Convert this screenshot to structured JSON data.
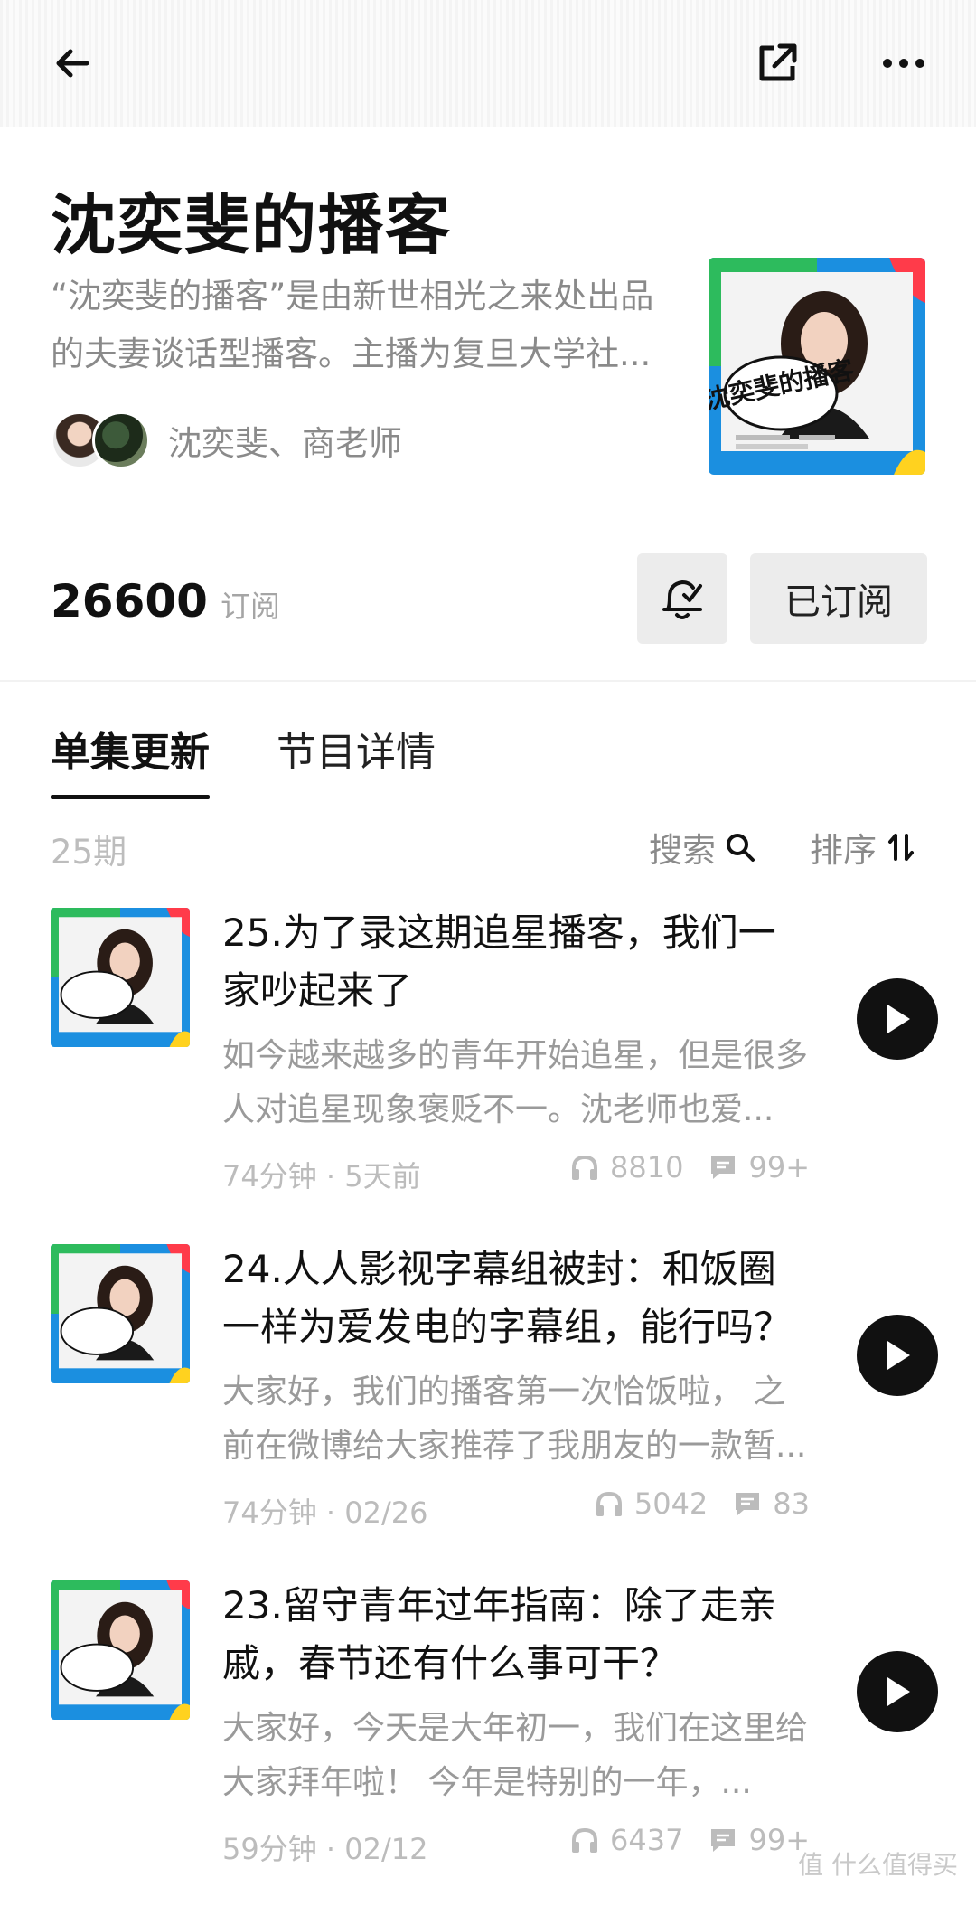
{
  "header": {
    "back_icon": "arrow-left-icon",
    "share_icon": "share-icon",
    "more_icon": "more-horizontal-icon"
  },
  "podcast": {
    "title": "沈奕斐的播客",
    "description": "“沈奕斐的播客”是由新世相光之来处出品的夫妻谈话型播客。主播为复旦大学社...",
    "hosts": "沈奕斐、商老师",
    "subscribers": "26600",
    "subscribers_label": "订阅",
    "subscribed_label": "已订阅",
    "cover_title": "沈奕斐的播客"
  },
  "tabs": [
    {
      "label": "单集更新",
      "active": true
    },
    {
      "label": "节目详情",
      "active": false
    }
  ],
  "list_header": {
    "count": "25期",
    "search_label": "搜索",
    "sort_label": "排序"
  },
  "episodes": [
    {
      "title": "25.为了录这期追星播客，我们一家吵起来了",
      "summary": "如今越来越多的青年开始追星，但是很多人对追星现象褒贬不一。沈老师也爱...",
      "duration_date": "74分钟 · 5天前",
      "plays": "8810",
      "comments": "99+"
    },
    {
      "title": "24.人人影视字幕组被封：和饭圈一样为爱发电的字幕组，能行吗？",
      "summary": "大家好，我们的播客第一次恰饭啦， 之前在微博给大家推荐了我朋友的一款暂...",
      "duration_date": "74分钟 · 02/26",
      "plays": "5042",
      "comments": "83"
    },
    {
      "title": "23.留守青年过年指南：除了走亲戚，春节还有什么事可干？",
      "summary": "大家好，今天是大年初一，我们在这里给大家拜年啦！ 今年是特别的一年，...",
      "duration_date": "59分钟 · 02/12",
      "plays": "6437",
      "comments": "99+"
    }
  ],
  "watermark": "值 什么值得买",
  "colors": {
    "cover_green": "#2dbb5d",
    "cover_blue": "#1b8fe0",
    "cover_red": "#ff3b4a",
    "cover_yellow": "#ffd21f"
  }
}
